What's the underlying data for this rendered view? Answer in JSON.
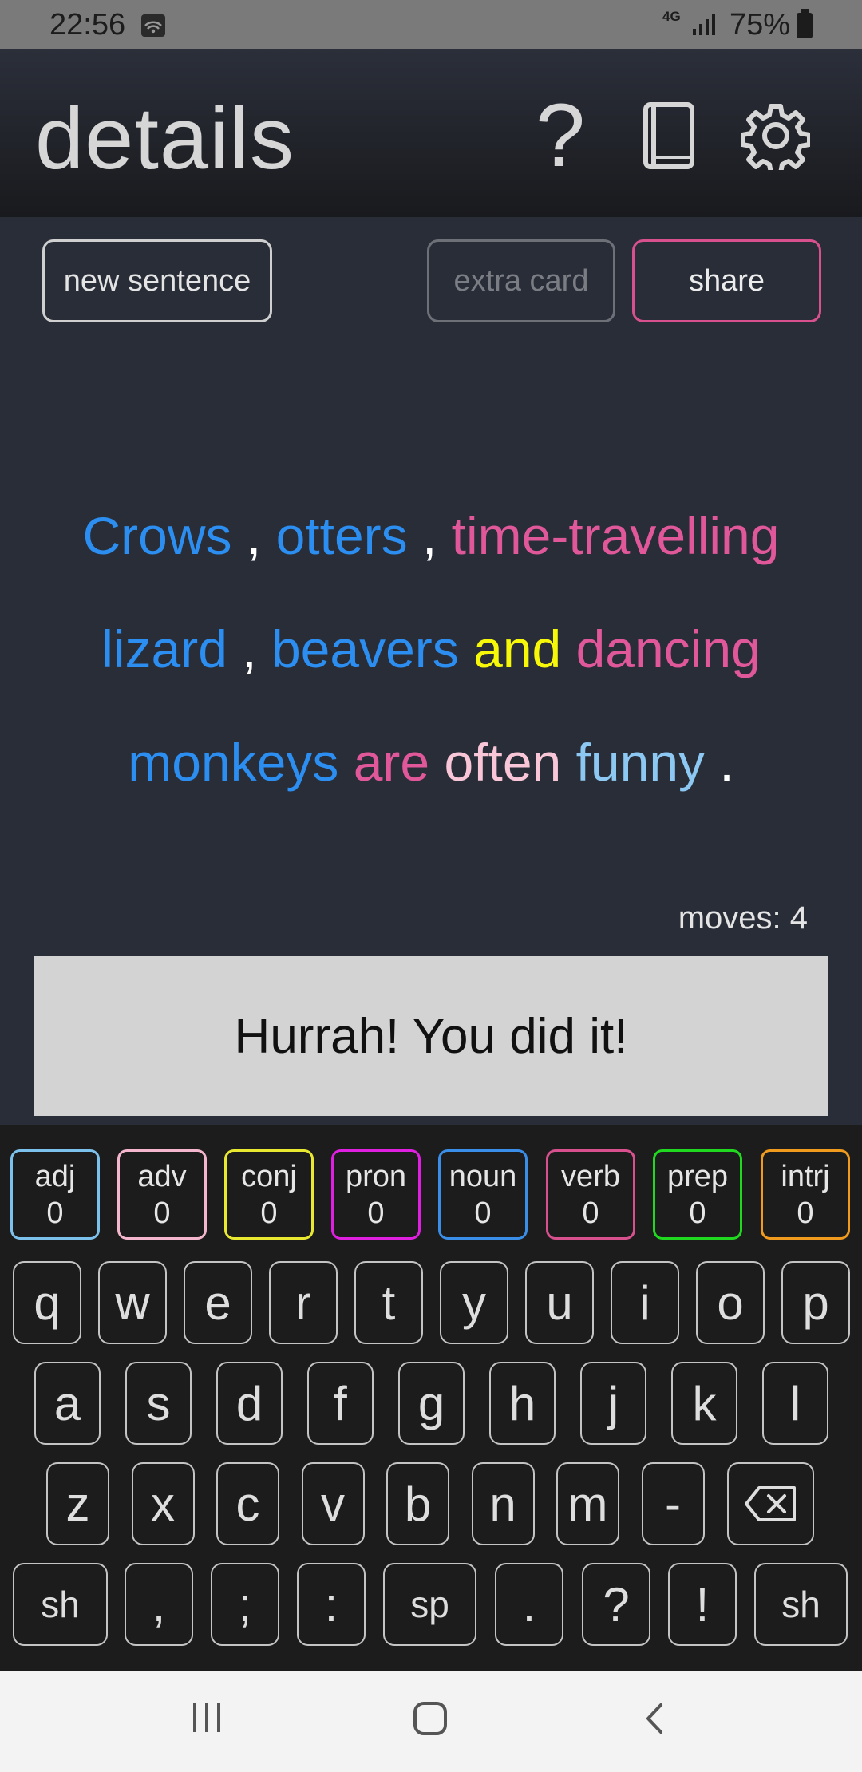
{
  "status_bar": {
    "time": "22:56",
    "network": "4G",
    "battery": "75%"
  },
  "header": {
    "title": "details",
    "help_label": "?"
  },
  "buttons": {
    "new_sentence": "new sentence",
    "extra_card": "extra card",
    "share": "share"
  },
  "sentence": [
    {
      "text": "Crows",
      "color": "#2b8ef0"
    },
    {
      "text": ",",
      "color": "#ffffff"
    },
    {
      "text": "otters",
      "color": "#2b8ef0"
    },
    {
      "text": ",",
      "color": "#ffffff"
    },
    {
      "text": "time-travelling",
      "color": "#e0579a"
    },
    {
      "text": "lizard",
      "color": "#2b8ef0"
    },
    {
      "text": ",",
      "color": "#ffffff"
    },
    {
      "text": "beavers",
      "color": "#2b8ef0"
    },
    {
      "text": "and",
      "color": "#f7f70a"
    },
    {
      "text": "dancing",
      "color": "#e0579a"
    },
    {
      "text": "monkeys",
      "color": "#2b8ef0"
    },
    {
      "text": "are",
      "color": "#e0579a"
    },
    {
      "text": "often",
      "color": "#f8c6d6"
    },
    {
      "text": "funny",
      "color": "#8cc8f2"
    },
    {
      "text": ".",
      "color": "#ffffff"
    }
  ],
  "moves": {
    "label": "moves:",
    "value": "4"
  },
  "message": "Hurrah! You did it!",
  "categories": [
    {
      "label": "adj",
      "count": "0",
      "color": "#7cc0ec"
    },
    {
      "label": "adv",
      "count": "0",
      "color": "#f4b6cc"
    },
    {
      "label": "conj",
      "count": "0",
      "color": "#e8e830"
    },
    {
      "label": "pron",
      "count": "0",
      "color": "#e020e0"
    },
    {
      "label": "noun",
      "count": "0",
      "color": "#3a8ee8"
    },
    {
      "label": "verb",
      "count": "0",
      "color": "#d9508f"
    },
    {
      "label": "prep",
      "count": "0",
      "color": "#20d820"
    },
    {
      "label": "intrj",
      "count": "0",
      "color": "#f09a1e"
    }
  ],
  "keyboard": {
    "row1": [
      "q",
      "w",
      "e",
      "r",
      "t",
      "y",
      "u",
      "i",
      "o",
      "p"
    ],
    "row2": [
      "a",
      "s",
      "d",
      "f",
      "g",
      "h",
      "j",
      "k",
      "l"
    ],
    "row3": [
      "z",
      "x",
      "c",
      "v",
      "b",
      "n",
      "m",
      "-"
    ],
    "row4": [
      "sh",
      ",",
      ";",
      ":",
      "sp",
      ".",
      "?",
      "!",
      "sh"
    ],
    "backspace_icon": "backspace-icon"
  }
}
